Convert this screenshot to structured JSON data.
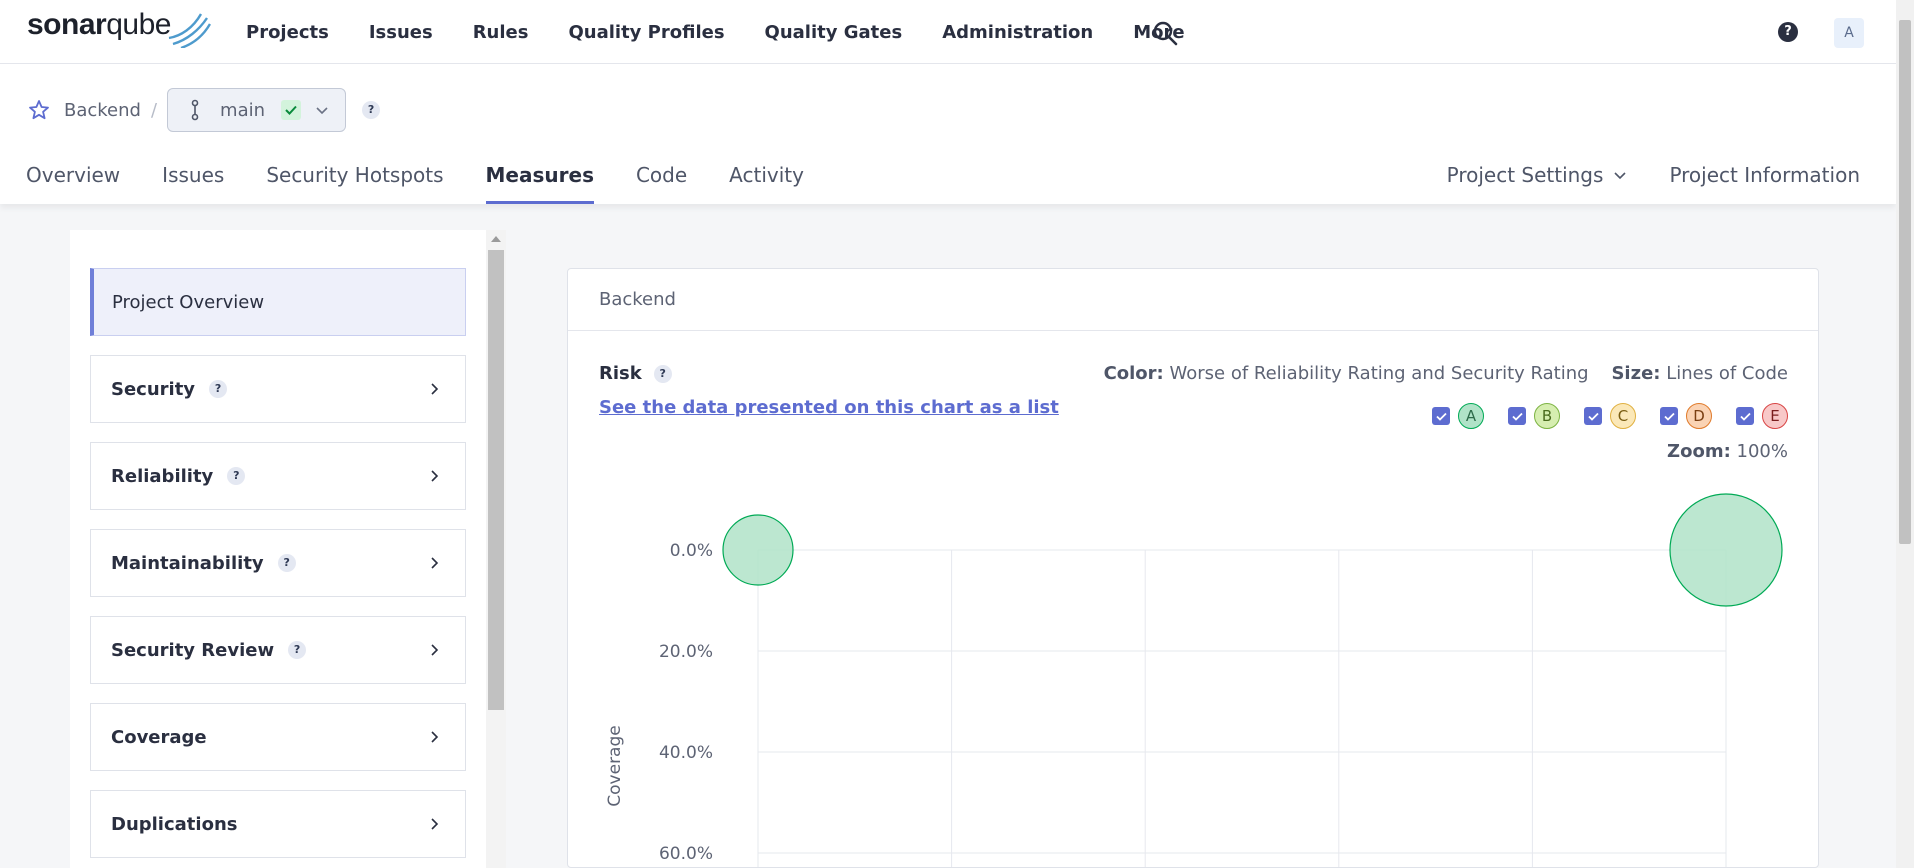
{
  "topnav": {
    "logo_text": "sonarqube",
    "menu": [
      "Projects",
      "Issues",
      "Rules",
      "Quality Profiles",
      "Quality Gates",
      "Administration",
      "More"
    ],
    "help_label": "?",
    "avatar_label": "A"
  },
  "project": {
    "name": "Backend",
    "separator": "/",
    "branch": "main",
    "help_label": "?"
  },
  "tabs": {
    "left": [
      "Overview",
      "Issues",
      "Security Hotspots",
      "Measures",
      "Code",
      "Activity"
    ],
    "active": "Measures",
    "settings": "Project Settings",
    "information": "Project Information"
  },
  "sidebar": {
    "overview": "Project Overview",
    "items": [
      {
        "label": "Security",
        "help": true
      },
      {
        "label": "Reliability",
        "help": true
      },
      {
        "label": "Maintainability",
        "help": true
      },
      {
        "label": "Security Review",
        "help": true
      },
      {
        "label": "Coverage",
        "help": false
      },
      {
        "label": "Duplications",
        "help": false
      }
    ],
    "help_label": "?"
  },
  "panel": {
    "header": "Backend",
    "risk_title": "Risk",
    "help_label": "?",
    "list_link": "See the data presented on this chart as a list",
    "color_label": "Color:",
    "color_value": "Worse of Reliability Rating and Security Rating",
    "size_label": "Size:",
    "size_value": "Lines of Code",
    "zoom_label": "Zoom:",
    "zoom_value": "100%",
    "ratings": [
      {
        "label": "A",
        "fill": "#b0e3c8",
        "stroke": "#00aa55",
        "text": "#2d6b4a"
      },
      {
        "label": "B",
        "fill": "#d6eeb0",
        "stroke": "#7cb342",
        "text": "#4a6b1e"
      },
      {
        "label": "C",
        "fill": "#fbe8b8",
        "stroke": "#e0b040",
        "text": "#7a5d12"
      },
      {
        "label": "D",
        "fill": "#fad3b4",
        "stroke": "#e07a2a",
        "text": "#7a3f12"
      },
      {
        "label": "E",
        "fill": "#f8c8c8",
        "stroke": "#d84545",
        "text": "#7a1e1e"
      }
    ]
  },
  "chart_data": {
    "type": "scatter",
    "ylabel": "Coverage",
    "y_ticks": [
      "0.0%",
      "20.0%",
      "40.0%",
      "60.0%"
    ],
    "ylim": [
      0,
      60
    ],
    "y_reversed": true,
    "x_grid_lines": 6,
    "points": [
      {
        "x_index": 0,
        "y": 0,
        "rating": "A",
        "size": "small"
      },
      {
        "x_index": 5,
        "y": 0,
        "rating": "A",
        "size": "large"
      }
    ],
    "bubble_color": "#b0e3c8",
    "bubble_stroke": "#00aa55"
  }
}
